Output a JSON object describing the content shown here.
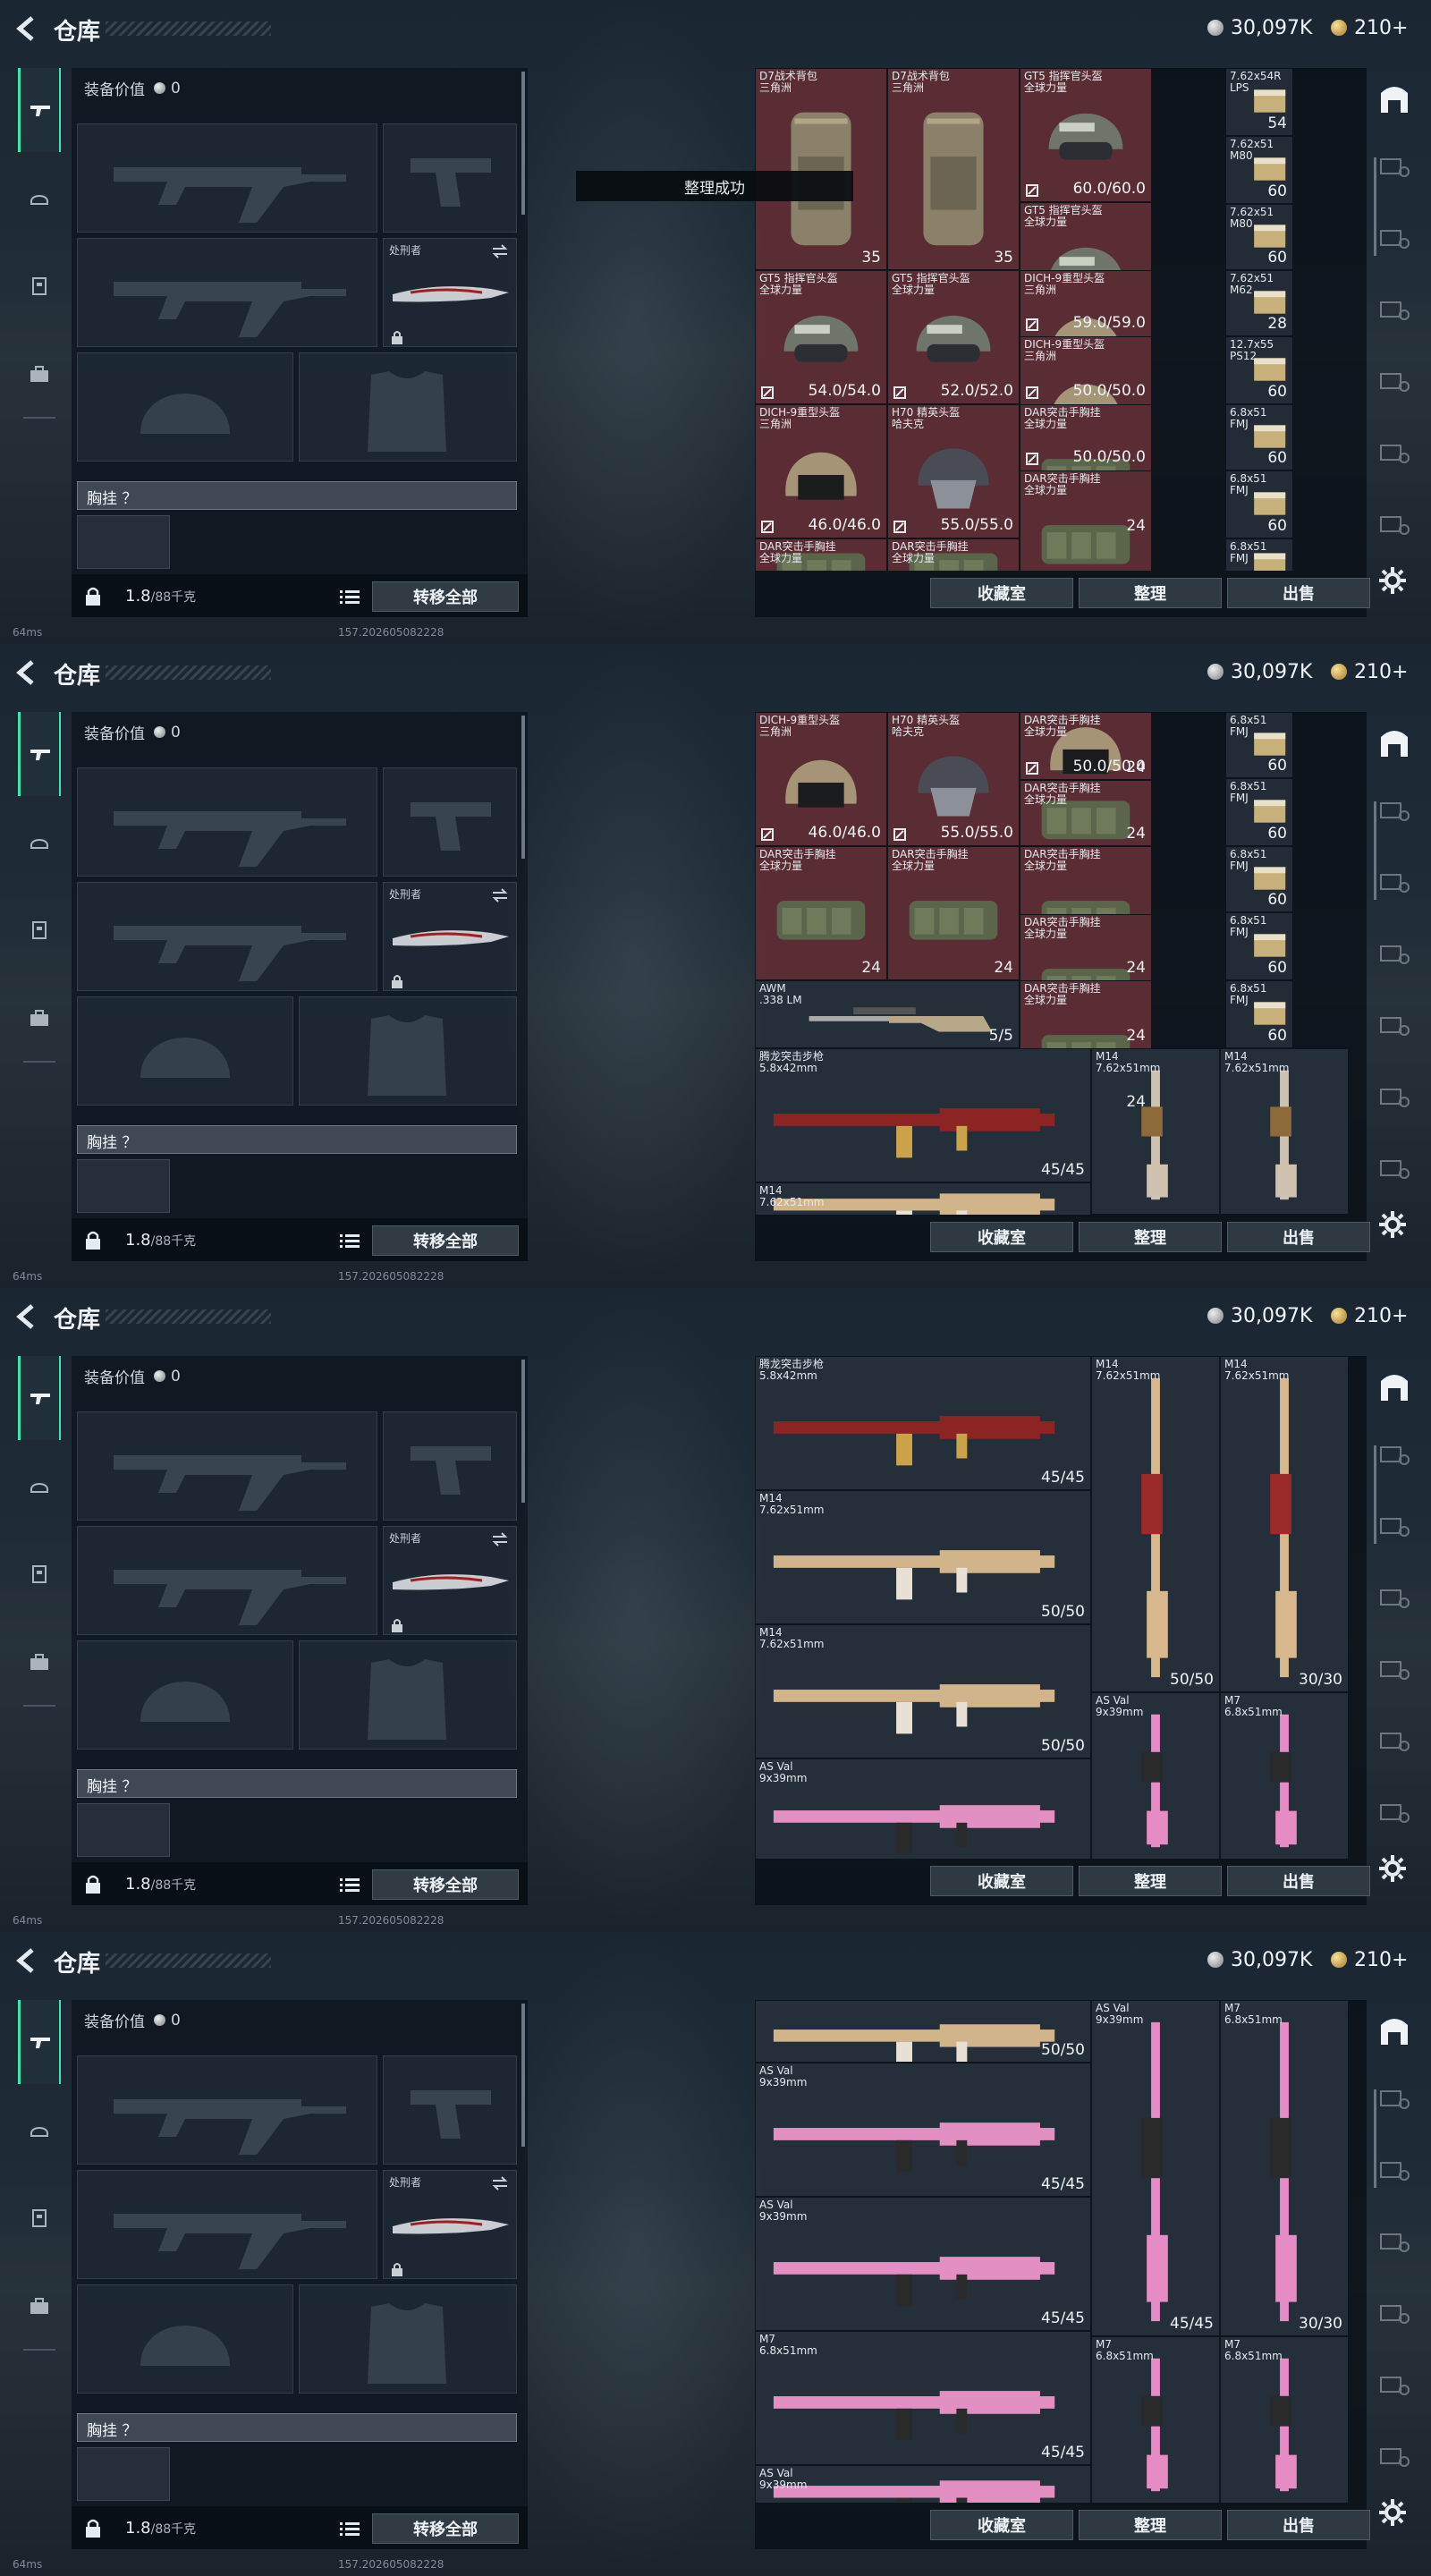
{
  "topbar": {
    "title": "仓库",
    "silver": "30,097K",
    "gold": "210+"
  },
  "toast": "整理成功",
  "equip": {
    "value_label": "装备价值",
    "value": "0",
    "melee_label": "处刑者",
    "rig_label": "胸挂 ？",
    "weight": "1.8",
    "weight_cap": "/88千克",
    "transfer_all": "转移全部"
  },
  "stash_buttons": {
    "collection": "收藏室",
    "sort": "整理",
    "sell": "出售"
  },
  "status": {
    "ping": "64ms",
    "build": "157.2026050822​28"
  },
  "colors": {
    "accent": "#41e2a6",
    "red_cell": "#5a2d34"
  },
  "panels": [
    {
      "cells": [
        {
          "name": "D7战术背包\n三角洲",
          "count": "35",
          "kind": "backpack",
          "red": true
        },
        {
          "name": "D7战术背包\n三角洲",
          "count": "35",
          "kind": "backpack",
          "red": true
        },
        {
          "name": "GT5 指挥官头盔\n全球力量",
          "durability": "60.0/60.0",
          "kind": "helmet",
          "red": true
        },
        {
          "name": "7.62x54R\nLPS",
          "count": "54",
          "kind": "ammo"
        },
        {
          "name": "7.62x51\nM80",
          "count": "60",
          "kind": "ammo"
        },
        {
          "name": "GT5 指挥官头盔\n全球力量",
          "durability": "59.0/59.0",
          "kind": "helmet",
          "red": true
        },
        {
          "name": "7.62x51\nM80",
          "count": "60",
          "kind": "ammo"
        },
        {
          "name": "GT5 指挥官头盔\n全球力量",
          "durability": "54.0/54.0",
          "kind": "helmet",
          "red": true
        },
        {
          "name": "GT5 指挥官头盔\n全球力量",
          "durability": "52.0/52.0",
          "kind": "helmet",
          "red": true
        },
        {
          "name": "DICH-9重型头盔\n三角洲",
          "durability": "50.0/50.0",
          "kind": "helmet2",
          "red": true
        },
        {
          "name": "7.62x51\nM62",
          "count": "28",
          "kind": "ammo"
        },
        {
          "name": "DICH-9重型头盔\n三角洲",
          "durability": "50.0/50.0",
          "kind": "helmet2",
          "red": true
        },
        {
          "name": "12.7x55\nPS12",
          "count": "60",
          "kind": "ammo"
        },
        {
          "name": "DICH-9重型头盔\n三角洲",
          "durability": "46.0/46.0",
          "kind": "helmet2",
          "red": true
        },
        {
          "name": "H70 精英头盔\n哈夫克",
          "durability": "55.0/55.0",
          "kind": "helmet3",
          "red": true
        },
        {
          "name": "DAR突击手胸挂\n全球力量",
          "count": "24",
          "kind": "rig",
          "red": true
        },
        {
          "name": "6.8x51\nFMJ",
          "count": "60",
          "kind": "ammo"
        },
        {
          "name": "DAR突击手胸挂\n全球力量",
          "count": "24",
          "kind": "rig",
          "red": true
        },
        {
          "name": "6.8x51\nFMJ",
          "count": "60",
          "kind": "ammo"
        },
        {
          "name": "DAR突击手胸挂\n全球力量",
          "count": "",
          "kind": "rig",
          "red": true
        },
        {
          "name": "DAR突击手胸挂\n全球力量",
          "count": "",
          "kind": "rig",
          "red": true
        },
        {
          "name": "6.8x51\nFMJ",
          "count": "",
          "kind": "ammo"
        }
      ]
    },
    {
      "cells": [
        {
          "name": "DICH-9重型头盔\n三角洲",
          "durability": "46.0/46.0",
          "kind": "helmet2",
          "red": true
        },
        {
          "name": "H70 精英头盔\n哈夫克",
          "durability": "55.0/55.0",
          "kind": "helmet3",
          "red": true
        },
        {
          "name": "DAR突击手胸挂\n全球力量",
          "count": "24",
          "kind": "rig",
          "red": true
        },
        {
          "name": "",
          "durability": "50.0/50.0",
          "kind": "helmet2",
          "red": true
        },
        {
          "name": "6.8x51\nFMJ",
          "count": "60",
          "kind": "ammo"
        },
        {
          "name": "DAR突击手胸挂\n全球力量",
          "count": "24",
          "kind": "rig",
          "red": true
        },
        {
          "name": "6.8x51\nFMJ",
          "count": "60",
          "kind": "ammo"
        },
        {
          "name": "DAR突击手胸挂\n全球力量",
          "count": "24",
          "kind": "rig",
          "red": true
        },
        {
          "name": "DAR突击手胸挂\n全球力量",
          "count": "24",
          "kind": "rig",
          "red": true
        },
        {
          "name": "DAR突击手胸挂\n全球力量",
          "count": "24",
          "kind": "rig",
          "red": true
        },
        {
          "name": "DAR突击手胸挂\n全球力量",
          "count": "24",
          "kind": "rig",
          "red": true
        },
        {
          "name": "6.8x51\nFMJ",
          "count": "60",
          "kind": "ammo"
        },
        {
          "name": "DAR突击手胸挂\n全球力量",
          "count": "24",
          "kind": "rig",
          "red": true
        },
        {
          "name": "6.8x51\nFMJ",
          "count": "60",
          "kind": "ammo"
        },
        {
          "name": "AWM\n.338 LM",
          "count": "5/5",
          "kind": "sniper"
        },
        {
          "name": "6.8x51\nFMJ",
          "count": "60",
          "kind": "ammo"
        },
        {
          "name": "腾龙突击步枪\n5.8x42mm",
          "count": "45/45",
          "kind": "rifle-red"
        },
        {
          "name": "M14\n7.62x51mm",
          "count": "",
          "kind": "vrifle"
        },
        {
          "name": "M14\n7.62x51mm",
          "count": "",
          "kind": "vrifle"
        },
        {
          "name": "M14\n7.62x51mm",
          "count": "",
          "kind": "rifle-gold"
        }
      ]
    },
    {
      "cells": [
        {
          "name": "腾龙突击步枪\n5.8x42mm",
          "count": "45/45",
          "kind": "rifle-red"
        },
        {
          "name": "M14\n7.62x51mm",
          "count": "50/50",
          "kind": "vrifle-gold"
        },
        {
          "name": "M14\n7.62x51mm",
          "count": "30/30",
          "kind": "vrifle-gold"
        },
        {
          "name": "M14\n7.62x51mm",
          "count": "50/50",
          "kind": "rifle-gold"
        },
        {
          "name": "M14\n7.62x51mm",
          "count": "50/50",
          "kind": "rifle-gold"
        },
        {
          "name": "AS Val\n9x39mm",
          "count": "",
          "kind": "vrifle-pink"
        },
        {
          "name": "M7\n6.8x51mm",
          "count": "",
          "kind": "vrifle-pink"
        },
        {
          "name": "AS Val\n9x39mm",
          "count": "",
          "kind": "rifle-pink"
        }
      ]
    },
    {
      "cells": [
        {
          "name": "",
          "count": "50/50",
          "kind": "rifle-gold"
        },
        {
          "name": "AS Val\n9x39mm",
          "count": "45/45",
          "kind": "vrifle-pink"
        },
        {
          "name": "M7\n6.8x51mm",
          "count": "30/30",
          "kind": "vrifle-pink"
        },
        {
          "name": "AS Val\n9x39mm",
          "count": "45/45",
          "kind": "rifle-pink"
        },
        {
          "name": "AS Val\n9x39mm",
          "count": "45/45",
          "kind": "rifle-pink"
        },
        {
          "name": "M7\n6.8x51mm",
          "count": "45/45",
          "kind": "rifle-pink"
        },
        {
          "name": "M7\n6.8x51mm",
          "count": "",
          "kind": "vrifle-pink"
        },
        {
          "name": "M7\n6.8x51mm",
          "count": "",
          "kind": "vrifle-pink"
        },
        {
          "name": "AS Val\n9x39mm",
          "count": "",
          "kind": "rifle-pink"
        }
      ]
    }
  ]
}
